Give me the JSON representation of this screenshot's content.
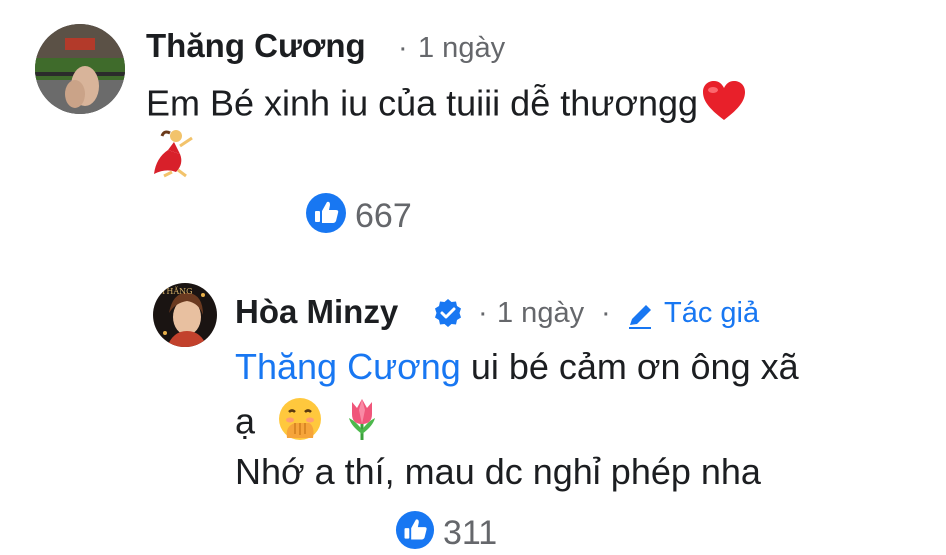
{
  "comment": {
    "author": "Thăng Cương",
    "dot": "·",
    "time": "1 ngày",
    "text": "Em Bé xinh iu của tuiii dễ thươngg",
    "like_count": "667",
    "icons": [
      "avatar-photo",
      "red-heart-emoji",
      "dancer-emoji",
      "like-icon"
    ],
    "colors": {
      "like_blue": "#1877f2",
      "meta_gray": "#65676b"
    }
  },
  "reply": {
    "author": "Hòa Minzy",
    "dot1": "·",
    "time": "1 ngày",
    "dot2": "·",
    "author_badge": "Tác giả",
    "mention": "Thăng Cương",
    "text_line1": " ui bé cảm ơn ông xã",
    "text_line2": "ạ",
    "text_line3": "Nhớ a thí, mau dc nghỉ phép nha",
    "like_count": "311",
    "icons": [
      "avatar-photo",
      "verified-badge-icon",
      "pencil-icon",
      "hand-over-mouth-emoji",
      "tulip-emoji",
      "like-icon"
    ],
    "avatar_text": "THĂNG"
  }
}
